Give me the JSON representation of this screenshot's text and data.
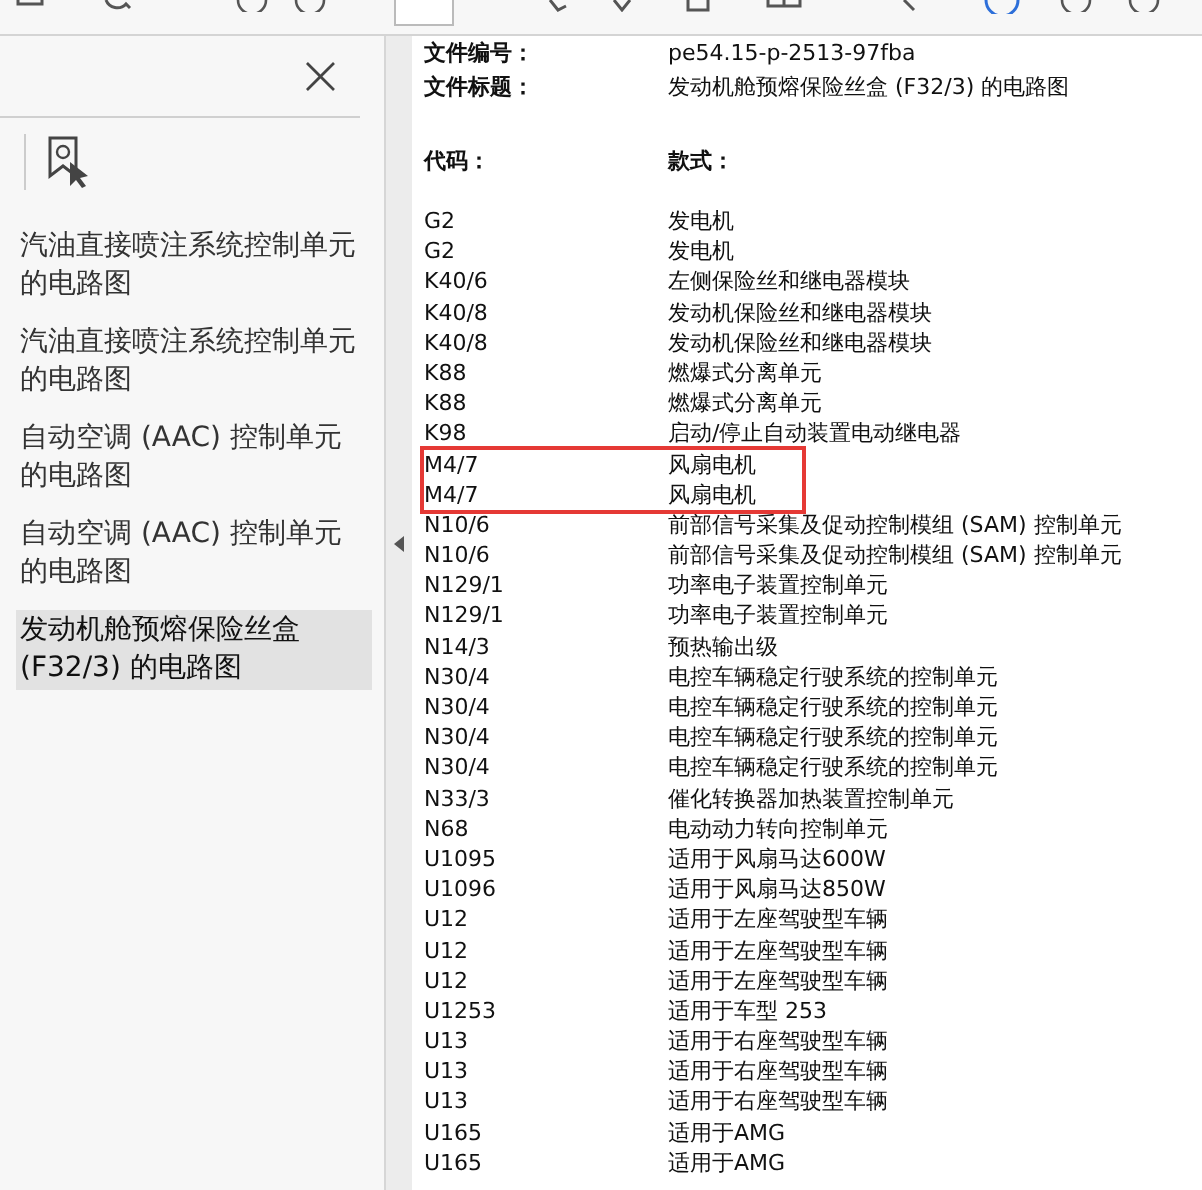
{
  "sidebar": {
    "close": "×",
    "bookmarks": [
      {
        "label": "汽油直接喷注系统控制单元的电路图",
        "selected": false
      },
      {
        "label": "汽油直接喷注系统控制单元的电路图",
        "selected": false
      },
      {
        "label": "自动空调 (AAC) 控制单元的电路图",
        "selected": false
      },
      {
        "label": "自动空调 (AAC) 控制单元的电路图",
        "selected": false
      },
      {
        "label": "发动机舱预熔保险丝盒 (F32/3) 的电路图",
        "selected": true
      }
    ]
  },
  "document": {
    "meta": [
      {
        "label": "文件编号：",
        "value": "pe54.15-p-2513-97fba"
      },
      {
        "label": "文件标题：",
        "value": "发动机舱预熔保险丝盒 (F32/3) 的电路图"
      }
    ],
    "columns": [
      "代码：",
      "款式："
    ],
    "rows": [
      {
        "code": "G2",
        "name": "发电机",
        "highlighted": false
      },
      {
        "code": "G2",
        "name": "发电机",
        "highlighted": false
      },
      {
        "code": "K40/6",
        "name": "左侧保险丝和继电器模块",
        "highlighted": false
      },
      {
        "code": "K40/8",
        "name": "发动机保险丝和继电器模块",
        "highlighted": false
      },
      {
        "code": "K40/8",
        "name": "发动机保险丝和继电器模块",
        "highlighted": false
      },
      {
        "code": "K88",
        "name": "燃爆式分离单元",
        "highlighted": false
      },
      {
        "code": "K88",
        "name": "燃爆式分离单元",
        "highlighted": false
      },
      {
        "code": "K98",
        "name": "启动/停止自动装置电动继电器",
        "highlighted": false
      },
      {
        "code": "M4/7",
        "name": "风扇电机",
        "highlighted": true
      },
      {
        "code": "M4/7",
        "name": "风扇电机",
        "highlighted": true
      },
      {
        "code": "N10/6",
        "name": "前部信号采集及促动控制模组 (SAM) 控制单元",
        "highlighted": false
      },
      {
        "code": "N10/6",
        "name": "前部信号采集及促动控制模组 (SAM) 控制单元",
        "highlighted": false
      },
      {
        "code": "N129/1",
        "name": "功率电子装置控制单元",
        "highlighted": false
      },
      {
        "code": "N129/1",
        "name": "功率电子装置控制单元",
        "highlighted": false
      },
      {
        "code": "N14/3",
        "name": "预热输出级",
        "highlighted": false
      },
      {
        "code": "N30/4",
        "name": "电控车辆稳定行驶系统的控制单元",
        "highlighted": false
      },
      {
        "code": "N30/4",
        "name": "电控车辆稳定行驶系统的控制单元",
        "highlighted": false
      },
      {
        "code": "N30/4",
        "name": "电控车辆稳定行驶系统的控制单元",
        "highlighted": false
      },
      {
        "code": "N30/4",
        "name": "电控车辆稳定行驶系统的控制单元",
        "highlighted": false
      },
      {
        "code": "N33/3",
        "name": "催化转换器加热装置控制单元",
        "highlighted": false
      },
      {
        "code": "N68",
        "name": "电动动力转向控制单元",
        "highlighted": false
      },
      {
        "code": "U1095",
        "name": "适用于风扇马达600W",
        "highlighted": false
      },
      {
        "code": "U1096",
        "name": "适用于风扇马达850W",
        "highlighted": false
      },
      {
        "code": "U12",
        "name": "适用于左座驾驶型车辆",
        "highlighted": false
      },
      {
        "code": "U12",
        "name": "适用于左座驾驶型车辆",
        "highlighted": false
      },
      {
        "code": "U12",
        "name": "适用于左座驾驶型车辆",
        "highlighted": false
      },
      {
        "code": "U1253",
        "name": "适用于车型 253",
        "highlighted": false
      },
      {
        "code": "U13",
        "name": "适用于右座驾驶型车辆",
        "highlighted": false
      },
      {
        "code": "U13",
        "name": "适用于右座驾驶型车辆",
        "highlighted": false
      },
      {
        "code": "U13",
        "name": "适用于右座驾驶型车辆",
        "highlighted": false
      },
      {
        "code": "U165",
        "name": "适用于AMG",
        "highlighted": false
      },
      {
        "code": "U165",
        "name": "适用于AMG",
        "highlighted": false
      }
    ]
  }
}
